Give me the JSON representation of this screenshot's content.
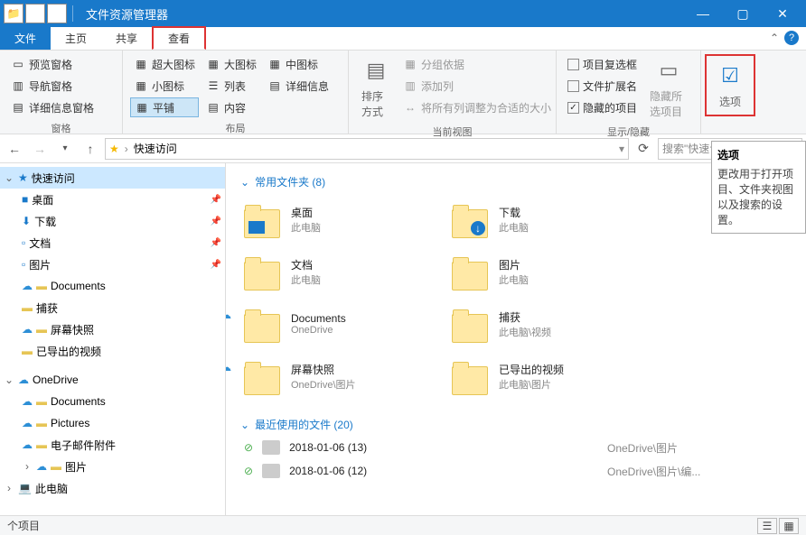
{
  "titlebar": {
    "title": "文件资源管理器"
  },
  "tabs": {
    "t0": "文件",
    "t1": "主页",
    "t2": "共享",
    "t3": "查看"
  },
  "ribbon": {
    "pane": {
      "preview": "预览窗格",
      "nav": "导航窗格",
      "details": "详细信息窗格",
      "label": "窗格"
    },
    "layout": {
      "xl": "超大图标",
      "lg": "大图标",
      "md": "中图标",
      "sm": "小图标",
      "list": "列表",
      "det": "详细信息",
      "tile": "平铺",
      "content": "内容",
      "label": "布局"
    },
    "view": {
      "sort": "排序方式",
      "group": "分组依据",
      "addcol": "添加列",
      "fit": "将所有列调整为合适的大小",
      "label": "当前视图"
    },
    "show": {
      "chk": "项目复选框",
      "ext": "文件扩展名",
      "hid": "隐藏的项目",
      "hidesel": "隐藏所选项目",
      "label": "显示/隐藏"
    },
    "opt": {
      "label": "选项"
    }
  },
  "tooltip": {
    "title": "选项",
    "body": "更改用于打开项目、文件夹视图以及搜索的设置。"
  },
  "address": {
    "path": "快速访问",
    "search": "搜索\"快速访问\""
  },
  "tree": {
    "quick": "快速访问",
    "desktop": "桌面",
    "downloads": "下载",
    "docs": "文档",
    "pics": "图片",
    "documents": "Documents",
    "capture": "捕获",
    "screenshot": "屏幕快照",
    "exported": "已导出的视频",
    "onedrive": "OneDrive",
    "odocs": "Documents",
    "opics": "Pictures",
    "email": "电子邮件附件",
    "oimg": "图片",
    "thispc": "此电脑"
  },
  "content": {
    "sec1": "常用文件夹 (8)",
    "folders": [
      {
        "n": "桌面",
        "l": "此电脑"
      },
      {
        "n": "下载",
        "l": "此电脑"
      },
      {
        "n": "文档",
        "l": "此电脑"
      },
      {
        "n": "图片",
        "l": "此电脑"
      },
      {
        "n": "Documents",
        "l": "OneDrive"
      },
      {
        "n": "捕获",
        "l": "此电脑\\视频"
      },
      {
        "n": "屏幕快照",
        "l": "OneDrive\\图片"
      },
      {
        "n": "已导出的视频",
        "l": "此电脑\\图片"
      }
    ],
    "sec2": "最近使用的文件 (20)",
    "recent": [
      {
        "n": "2018-01-06 (13)",
        "l": "OneDrive\\图片"
      },
      {
        "n": "2018-01-06 (12)",
        "l": "OneDrive\\图片\\编..."
      }
    ]
  },
  "status": {
    "count": "个项目"
  }
}
